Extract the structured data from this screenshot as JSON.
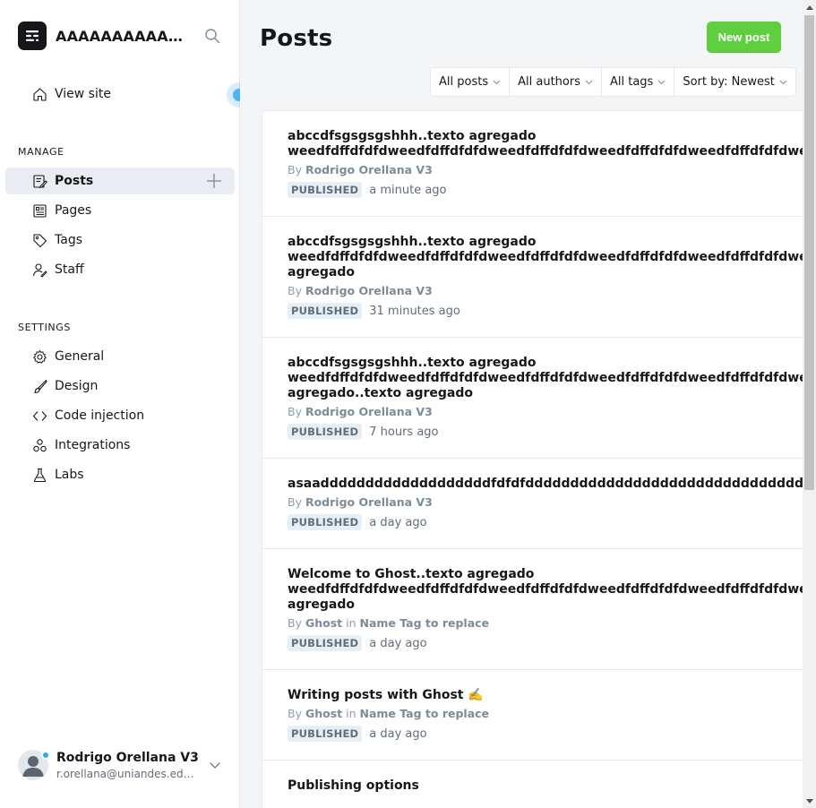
{
  "sidebar": {
    "site_title": "AAAAAAAAAAAAAAAAA",
    "view_site": "View site",
    "manage_title": "MANAGE",
    "manage_items": [
      {
        "label": "Posts",
        "icon": "posts-icon"
      },
      {
        "label": "Pages",
        "icon": "pages-icon"
      },
      {
        "label": "Tags",
        "icon": "tag-icon"
      },
      {
        "label": "Staff",
        "icon": "staff-icon"
      }
    ],
    "settings_title": "SETTINGS",
    "settings_items": [
      {
        "label": "General",
        "icon": "gear-icon"
      },
      {
        "label": "Design",
        "icon": "brush-icon"
      },
      {
        "label": "Code injection",
        "icon": "code-icon"
      },
      {
        "label": "Integrations",
        "icon": "integrations-icon"
      },
      {
        "label": "Labs",
        "icon": "flask-icon"
      }
    ],
    "user": {
      "name": "Rodrigo Orellana V3",
      "email": "r.orellana@uniandes.edu.co"
    }
  },
  "main": {
    "title": "Posts",
    "new_post_label": "New post",
    "filters": [
      "All posts",
      "All authors",
      "All tags",
      "Sort by: Newest"
    ],
    "posts": [
      {
        "title": "abccdfsgsgsgshhh..texto agregado\nweedfdffdfdfdweedfdffdfdfdweedfdffdfdfdweedfdffdfdfdweedfdffdfdfdweedfdffdfdfdweedfdffdfdfd",
        "by": "By",
        "author": "Rodrigo Orellana V3",
        "in": "",
        "tag": "",
        "status": "PUBLISHED",
        "time": "a minute ago"
      },
      {
        "title": "abccdfsgsgsgshhh..texto agregado\nweedfdffdfdfdweedfdffdfdfdweedfdffdfdfdweedfdffdfdfdweedfdffdfdfdweedfdffdfdfd\nagregado",
        "by": "By",
        "author": "Rodrigo Orellana V3",
        "in": "",
        "tag": "",
        "status": "PUBLISHED",
        "time": "31 minutes ago"
      },
      {
        "title": "abccdfsgsgsgshhh..texto agregado\nweedfdffdfdfdweedfdffdfdfdweedfdffdfdfdweedfdffdfdfdweedfdffdfdfdweedfdffdfdfd\nagregado..texto agregado",
        "by": "By",
        "author": "Rodrigo Orellana V3",
        "in": "",
        "tag": "",
        "status": "PUBLISHED",
        "time": "7 hours ago"
      },
      {
        "title": "asaadddddddddddddddddddfdfdfdddddddddddddddddddddddddddddddddddddddddddd",
        "by": "By",
        "author": "Rodrigo Orellana V3",
        "in": "",
        "tag": "",
        "status": "PUBLISHED",
        "time": "a day ago"
      },
      {
        "title": "Welcome to Ghost..texto agregado\nweedfdffdfdfdweedfdffdfdfdweedfdffdfdfdweedfdffdfdfdweedfdffdfdfdweedfdffdfdfd\nagregado",
        "by": "By",
        "author": "Ghost",
        "in": "in",
        "tag": "Name Tag to replace",
        "status": "PUBLISHED",
        "time": "a day ago"
      },
      {
        "title": "Writing posts with Ghost ✍️",
        "by": "By",
        "author": "Ghost",
        "in": "in",
        "tag": "Name Tag to replace",
        "status": "PUBLISHED",
        "time": "a day ago"
      },
      {
        "title": "Publishing options",
        "by": "",
        "author": "",
        "in": "",
        "tag": "",
        "status": "",
        "time": ""
      }
    ]
  },
  "colors": {
    "accent_green": "#5fcf40",
    "active_nav_bg": "#e9ecf1",
    "badge_bg": "#e5eff5",
    "presence_dot": "#30a9e8"
  }
}
